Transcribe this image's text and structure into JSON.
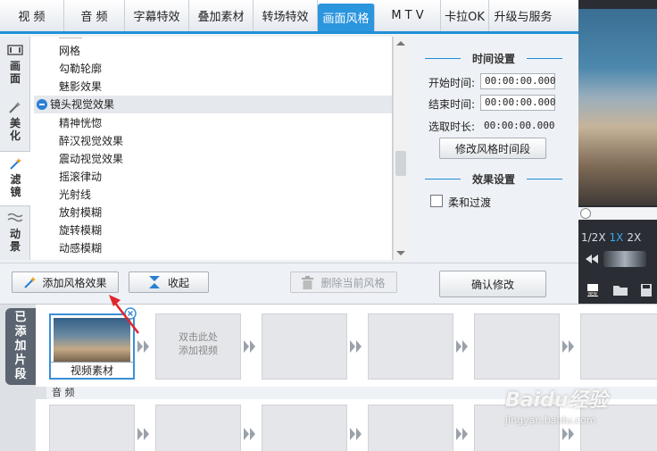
{
  "tabs": [
    "视 频",
    "音 频",
    "字幕特效",
    "叠加素材",
    "转场特效",
    "画面风格",
    "M T V",
    "卡拉OK",
    "升级与服务"
  ],
  "active_tab": "画面风格",
  "side_tabs": [
    "画面",
    "美化",
    "滤镜",
    "动景"
  ],
  "active_side_tab": "滤镜",
  "effect_list": {
    "items_before": [
      "网格",
      "勾勒轮廓",
      "魅影效果"
    ],
    "group": "镜头视觉效果",
    "group_items": [
      "精神恍惚",
      "醉汉视觉效果",
      "震动视觉效果",
      "摇滚律动",
      "光射线",
      "放射模糊",
      "旋转模糊",
      "动感模糊"
    ]
  },
  "time_settings": {
    "title": "时间设置",
    "start_label": "开始时间:",
    "start_value": "00:00:00.000",
    "end_label": "结束时间:",
    "end_value": "00:00:00.000",
    "duration_label": "选取时长:",
    "duration_value": "00:00:00.000",
    "modify_button": "修改风格时间段"
  },
  "effect_settings": {
    "title": "效果设置",
    "smooth_label": "柔和过渡",
    "smooth_checked": false
  },
  "buttons": {
    "add_style": "添加风格效果",
    "collapse": "收起",
    "delete_current": "删除当前风格",
    "confirm": "确认修改"
  },
  "preview": {
    "speeds": [
      "1/2X",
      "1X",
      "2X"
    ],
    "active_speed": "1X"
  },
  "clips": {
    "panel_label": [
      "已",
      "添",
      "加",
      "片",
      "段"
    ],
    "first_clip_caption": "视频素材",
    "empty_hint_line1": "双击此处",
    "empty_hint_line2": "添加视频",
    "audio_label": "音 频"
  },
  "watermark": {
    "brand": "Baidu经验",
    "url": "jingyan.baidu.com"
  },
  "colors": {
    "accent": "#2b95de",
    "list_group_bg": "#e5e8ec",
    "annotation_arrow": "#e0262c"
  }
}
